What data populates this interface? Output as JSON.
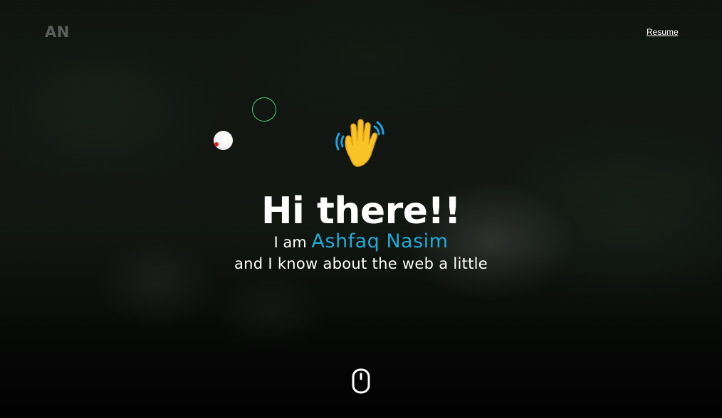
{
  "header": {
    "logo_text": "AN",
    "resume_link": "Resume"
  },
  "hero": {
    "wave_icon": "waving-hand-icon",
    "headline": "Hi there!!",
    "intro_prefix": "I am",
    "name": "Ashfaq Nasim",
    "tagline": "and I know about the web a little"
  },
  "footer": {
    "scroll_icon": "mouse-scroll-icon"
  },
  "decorations": {
    "ring_icon": "green-ring-icon",
    "ball_icon": "white-ball-icon"
  },
  "colors": {
    "name_accent": "#22a9d6",
    "ring": "#4fd27a",
    "logo": "#5b5f5b",
    "text": "#ffffff"
  }
}
